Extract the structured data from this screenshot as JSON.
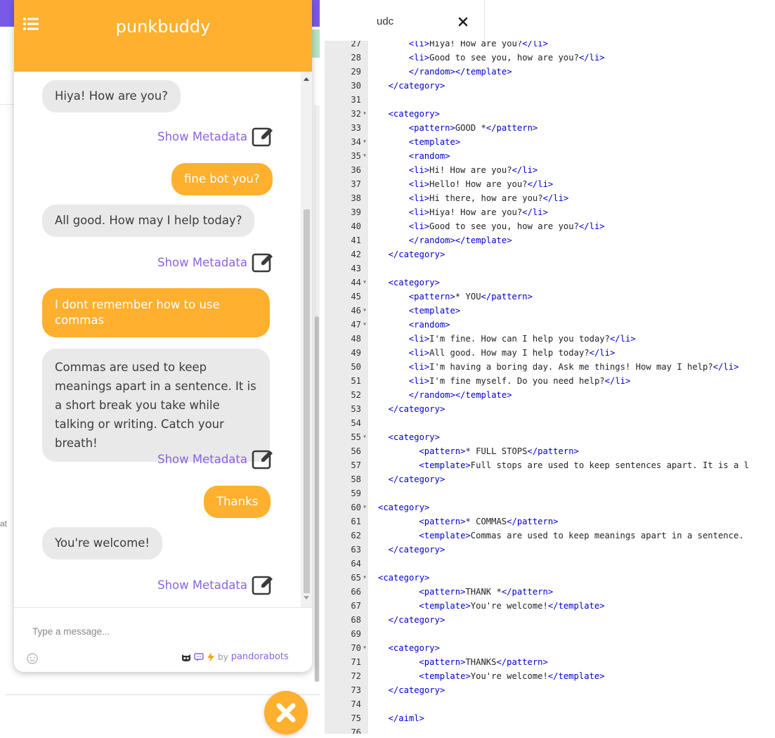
{
  "chat": {
    "title": "punkbuddy",
    "messages": [
      {
        "from": "bot",
        "text": "Hiya! How are you?"
      },
      {
        "from": "user",
        "text": "fine bot you?"
      },
      {
        "from": "bot",
        "text": "All good. How may I help today?"
      },
      {
        "from": "user",
        "text": "I dont remember how to use commas"
      },
      {
        "from": "bot",
        "text": "Commas are used to keep meanings apart in a sentence. It is a short break you take while talking or writing. Catch your breath!"
      },
      {
        "from": "user",
        "text": "Thanks"
      },
      {
        "from": "bot",
        "text": "You're welcome!"
      }
    ],
    "metadata_label": "Show Metadata",
    "input_placeholder": "Type a message...",
    "powered_by": "by",
    "brand": "pandorabots",
    "colors": {
      "accent": "#ffb02e",
      "link": "#8a63e0",
      "bot_bubble": "#e9e9e9"
    }
  },
  "background": {
    "fragment": "at"
  },
  "editor": {
    "tab_name": "udc",
    "lines": [
      {
        "n": "27",
        "fold": false,
        "indent": 6,
        "code": "<li>Hiya! How are you?</li>"
      },
      {
        "n": "28",
        "fold": false,
        "indent": 6,
        "code": "<li>Good to see you, how are you?</li>"
      },
      {
        "n": "29",
        "fold": false,
        "indent": 6,
        "code": "</random></template>"
      },
      {
        "n": "30",
        "fold": false,
        "indent": 2,
        "code": "</category>"
      },
      {
        "n": "31",
        "fold": false,
        "indent": 0,
        "code": ""
      },
      {
        "n": "32",
        "fold": true,
        "indent": 2,
        "code": "<category>"
      },
      {
        "n": "33",
        "fold": false,
        "indent": 6,
        "code": "<pattern>GOOD *</pattern>"
      },
      {
        "n": "34",
        "fold": true,
        "indent": 6,
        "code": "<template>"
      },
      {
        "n": "35",
        "fold": true,
        "indent": 6,
        "code": "<random>"
      },
      {
        "n": "36",
        "fold": false,
        "indent": 6,
        "code": "<li>Hi! How are you?</li>"
      },
      {
        "n": "37",
        "fold": false,
        "indent": 6,
        "code": "<li>Hello! How are you?</li>"
      },
      {
        "n": "38",
        "fold": false,
        "indent": 6,
        "code": "<li>Hi there, how are you?</li>"
      },
      {
        "n": "39",
        "fold": false,
        "indent": 6,
        "code": "<li>Hiya! How are you?</li>"
      },
      {
        "n": "40",
        "fold": false,
        "indent": 6,
        "code": "<li>Good to see you, how are you?</li>"
      },
      {
        "n": "41",
        "fold": false,
        "indent": 6,
        "code": "</random></template>"
      },
      {
        "n": "42",
        "fold": false,
        "indent": 2,
        "code": "</category>"
      },
      {
        "n": "43",
        "fold": false,
        "indent": 0,
        "code": ""
      },
      {
        "n": "44",
        "fold": true,
        "indent": 2,
        "code": "<category>"
      },
      {
        "n": "45",
        "fold": false,
        "indent": 6,
        "code": "<pattern>* YOU</pattern>"
      },
      {
        "n": "46",
        "fold": true,
        "indent": 6,
        "code": "<template>"
      },
      {
        "n": "47",
        "fold": true,
        "indent": 6,
        "code": "<random>"
      },
      {
        "n": "48",
        "fold": false,
        "indent": 6,
        "code": "<li>I'm fine. How can I help you today?</li>"
      },
      {
        "n": "49",
        "fold": false,
        "indent": 6,
        "code": "<li>All good. How may I help today?</li>"
      },
      {
        "n": "50",
        "fold": false,
        "indent": 6,
        "code": "<li>I'm having a boring day. Ask me things! How may I help?</li>"
      },
      {
        "n": "51",
        "fold": false,
        "indent": 6,
        "code": "<li>I'm fine myself. Do you need help?</li>"
      },
      {
        "n": "52",
        "fold": false,
        "indent": 6,
        "code": "</random></template>"
      },
      {
        "n": "53",
        "fold": false,
        "indent": 2,
        "code": "</category>"
      },
      {
        "n": "54",
        "fold": false,
        "indent": 0,
        "code": ""
      },
      {
        "n": "55",
        "fold": true,
        "indent": 2,
        "code": "<category>"
      },
      {
        "n": "56",
        "fold": false,
        "indent": 8,
        "code": "<pattern>* FULL STOPS</pattern>"
      },
      {
        "n": "57",
        "fold": false,
        "indent": 8,
        "code": "<template>Full stops are used to keep sentences apart. It is a l"
      },
      {
        "n": "58",
        "fold": false,
        "indent": 2,
        "code": "</category>"
      },
      {
        "n": "59",
        "fold": false,
        "indent": 0,
        "code": ""
      },
      {
        "n": "60",
        "fold": true,
        "indent": 0,
        "code": "<category>"
      },
      {
        "n": "61",
        "fold": false,
        "indent": 8,
        "code": "<pattern>* COMMAS</pattern>"
      },
      {
        "n": "62",
        "fold": false,
        "indent": 8,
        "code": "<template>Commas are used to keep meanings apart in a sentence."
      },
      {
        "n": "63",
        "fold": false,
        "indent": 2,
        "code": "</category>"
      },
      {
        "n": "64",
        "fold": false,
        "indent": 0,
        "code": ""
      },
      {
        "n": "65",
        "fold": true,
        "indent": 0,
        "code": "<category>"
      },
      {
        "n": "66",
        "fold": false,
        "indent": 8,
        "code": "<pattern>THANK *</pattern>"
      },
      {
        "n": "67",
        "fold": false,
        "indent": 8,
        "code": "<template>You're welcome!</template>"
      },
      {
        "n": "68",
        "fold": false,
        "indent": 2,
        "code": "</category>"
      },
      {
        "n": "69",
        "fold": false,
        "indent": 0,
        "code": ""
      },
      {
        "n": "70",
        "fold": true,
        "indent": 2,
        "code": "<category>"
      },
      {
        "n": "71",
        "fold": false,
        "indent": 8,
        "code": "<pattern>THANKS</pattern>"
      },
      {
        "n": "72",
        "fold": false,
        "indent": 8,
        "code": "<template>You're welcome!</template>"
      },
      {
        "n": "73",
        "fold": false,
        "indent": 2,
        "code": "</category>"
      },
      {
        "n": "74",
        "fold": false,
        "indent": 0,
        "code": ""
      },
      {
        "n": "75",
        "fold": false,
        "indent": 2,
        "code": "</aiml>"
      },
      {
        "n": "76",
        "fold": false,
        "indent": 0,
        "code": ""
      }
    ]
  }
}
